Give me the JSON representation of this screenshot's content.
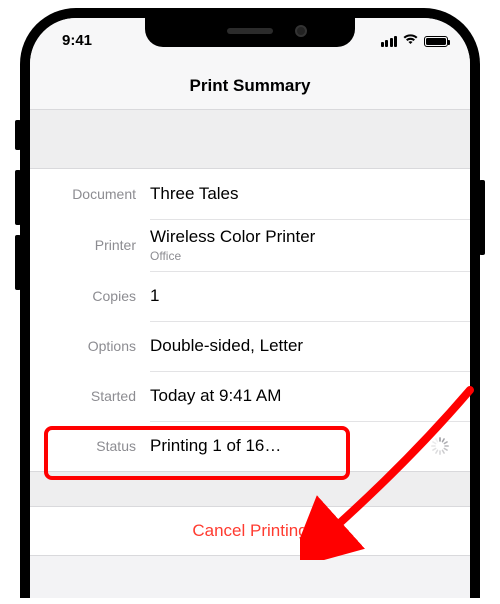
{
  "status_bar": {
    "time": "9:41"
  },
  "nav": {
    "title": "Print Summary"
  },
  "rows": {
    "document": {
      "label": "Document",
      "value": "Three Tales"
    },
    "printer": {
      "label": "Printer",
      "value": "Wireless Color Printer",
      "sub": "Office"
    },
    "copies": {
      "label": "Copies",
      "value": "1"
    },
    "options": {
      "label": "Options",
      "value": "Double-sided, Letter"
    },
    "started": {
      "label": "Started",
      "value": "Today at 9:41 AM"
    },
    "status": {
      "label": "Status",
      "value": "Printing 1 of 16…"
    }
  },
  "cancel": {
    "label": "Cancel Printing"
  }
}
